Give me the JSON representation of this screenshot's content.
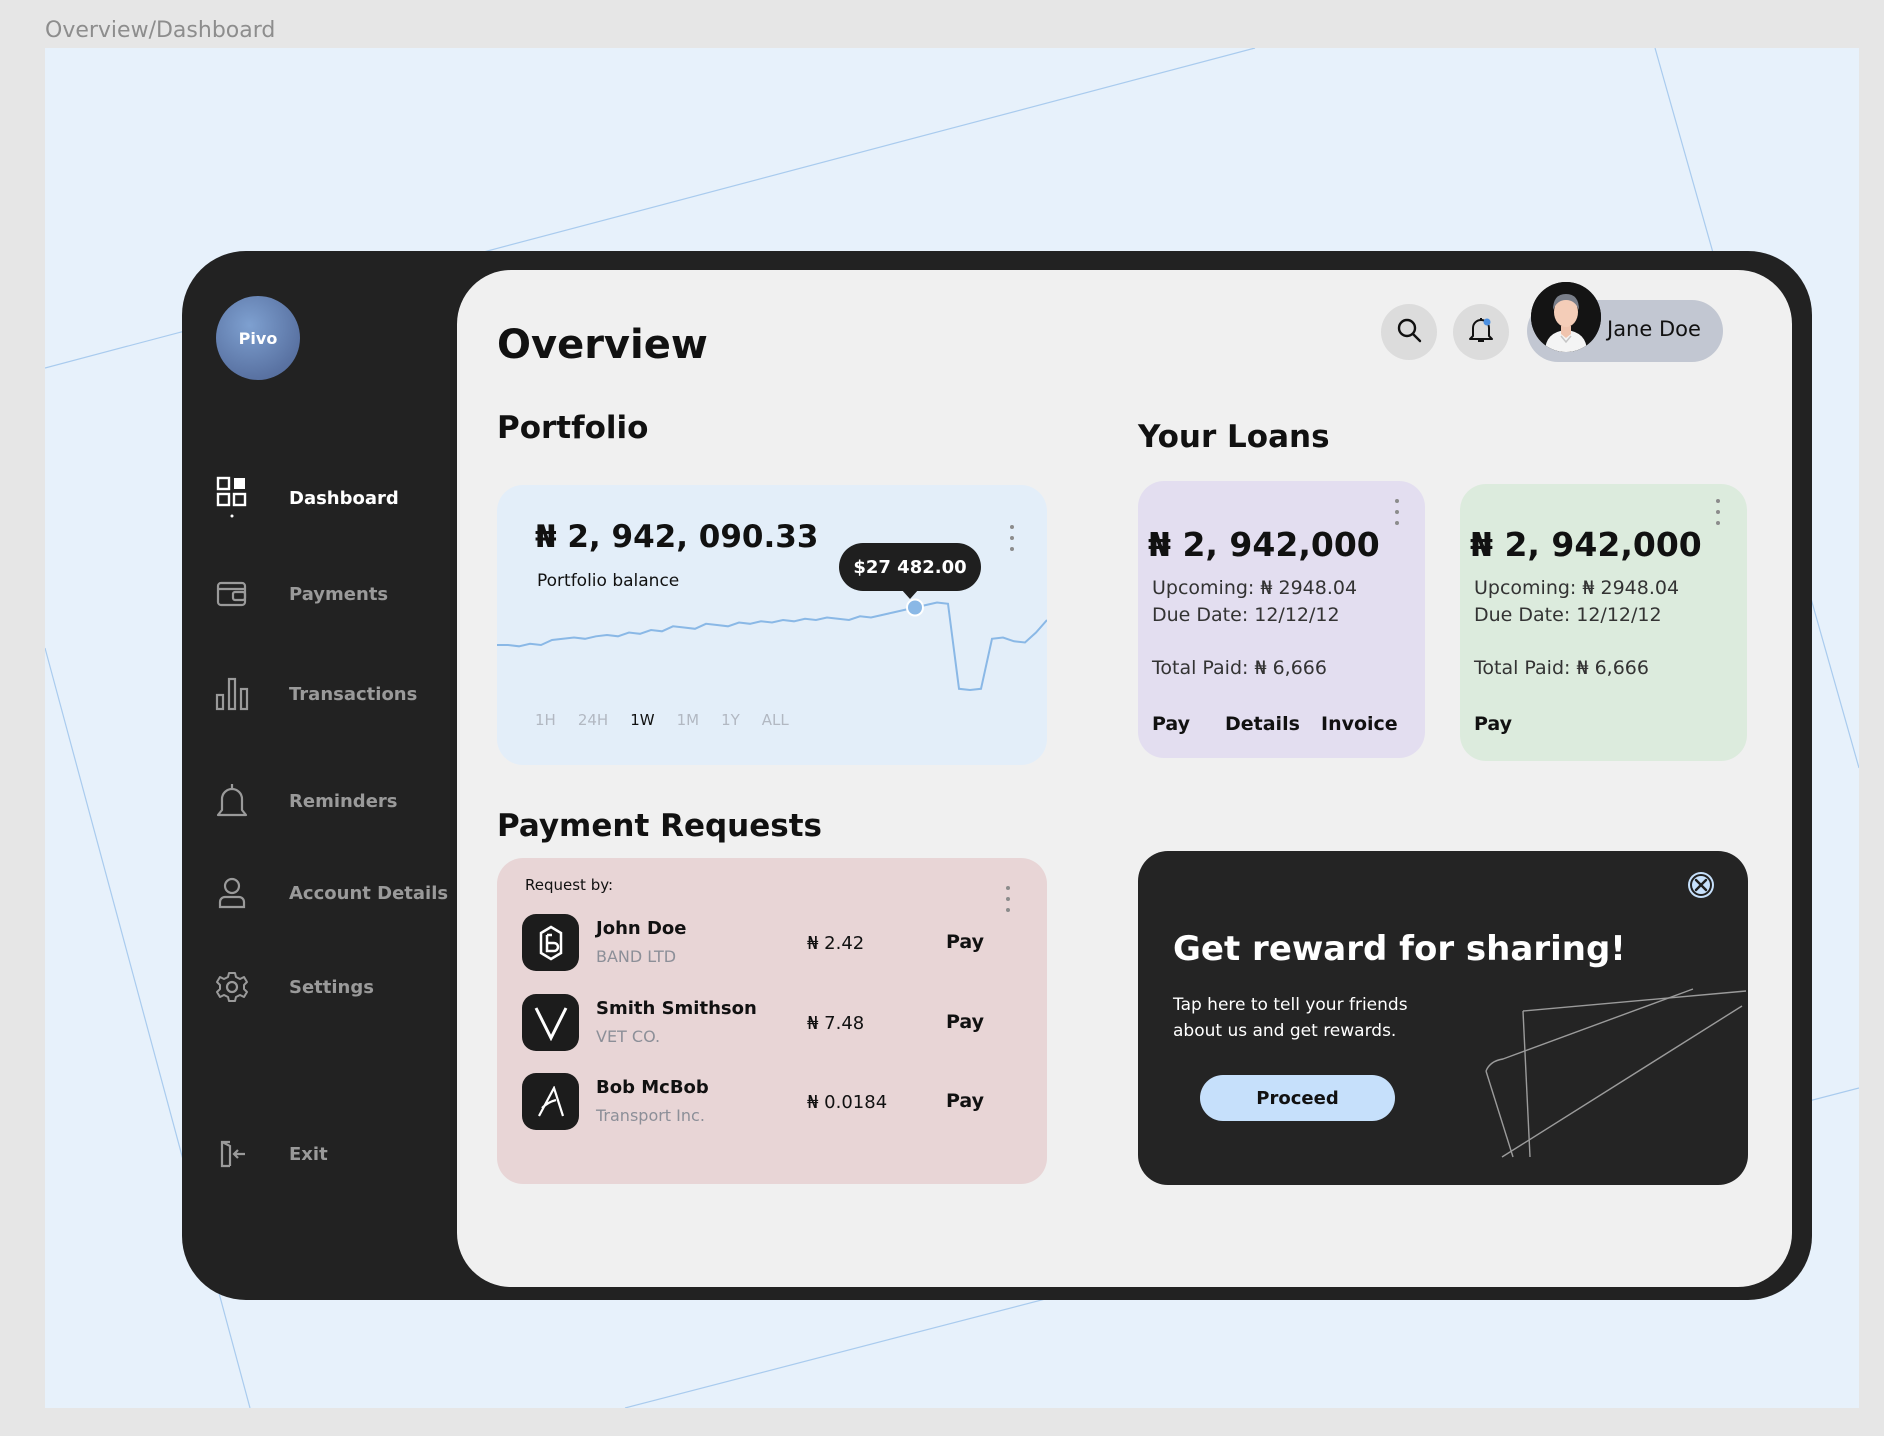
{
  "frame_label": "Overview/Dashboard",
  "brand": {
    "logo_text": "Pivo"
  },
  "sidebar": {
    "items": [
      {
        "label": "Dashboard",
        "icon": "dashboard-grid-icon",
        "active": true
      },
      {
        "label": "Payments",
        "icon": "wallet-icon"
      },
      {
        "label": "Transactions",
        "icon": "bar-chart-icon"
      },
      {
        "label": "Reminders",
        "icon": "bell-icon"
      },
      {
        "label": "Account Details",
        "icon": "user-icon"
      },
      {
        "label": "Settings",
        "icon": "gear-icon"
      }
    ],
    "exit_label": "Exit"
  },
  "header": {
    "title": "Overview",
    "user_name": "Jane Doe",
    "search_icon": "search-icon",
    "notification_icon": "bell-notification-icon"
  },
  "portfolio": {
    "section_title": "Portfolio",
    "balance": "₦ 2, 942, 090.33",
    "balance_label": "Portfolio balance",
    "tooltip": "$27 482.00",
    "ranges": [
      "1H",
      "24H",
      "1W",
      "1M",
      "1Y",
      "ALL"
    ],
    "active_range": "1W"
  },
  "chart_data": {
    "type": "line",
    "series": [
      {
        "values": [
          40,
          40,
          39,
          41,
          40,
          44,
          45,
          46,
          45,
          47,
          48,
          47,
          50,
          49,
          52,
          51,
          55,
          54,
          53,
          57,
          56,
          55,
          58,
          57,
          59,
          58,
          60,
          59,
          61,
          60,
          62,
          61,
          60,
          63,
          62,
          64,
          66,
          68,
          70,
          72,
          74,
          73,
          5,
          4,
          5,
          45,
          46,
          43,
          42,
          50,
          60
        ]
      }
    ],
    "highlight_value": 27482.0,
    "highlight_label": "$27 482.00",
    "grid": false,
    "legend": "none"
  },
  "loans": {
    "section_title": "Your Loans",
    "cards": [
      {
        "amount": "₦ 2, 942,000",
        "upcoming": "Upcoming: ₦ 2948.04",
        "due_date": "Due Date: 12/12/12",
        "total_paid": "Total Paid: ₦ 6,666",
        "actions": [
          "Pay",
          "Details",
          "Invoice"
        ],
        "color": "#e3def0"
      },
      {
        "amount": "₦ 2, 942,000",
        "upcoming": "Upcoming: ₦ 2948.04",
        "due_date": "Due Date: 12/12/12",
        "total_paid": "Total Paid: ₦ 6,666",
        "actions": [
          "Pay"
        ],
        "color": "#dcebdd"
      }
    ]
  },
  "payment_requests": {
    "section_title": "Payment Requests",
    "header": "Request by:",
    "rows": [
      {
        "name": "John Doe",
        "company": "BAND LTD",
        "amount": "₦ 2.42",
        "action": "Pay",
        "logo_icon": "band-logo-icon"
      },
      {
        "name": "Smith Smithson",
        "company": "VET CO.",
        "amount": "₦ 7.48",
        "action": "Pay",
        "logo_icon": "v-logo-icon"
      },
      {
        "name": "Bob McBob",
        "company": "Transport Inc.",
        "amount": "₦ 0.0184",
        "action": "Pay",
        "logo_icon": "a-logo-icon"
      }
    ]
  },
  "reward": {
    "title": "Get reward for sharing!",
    "text": "Tap here to tell your friends about us and get rewards.",
    "button": "Proceed",
    "close_icon": "close-circle-icon"
  },
  "colors": {
    "sidebar_bg": "#222222",
    "main_bg": "#f0f0f0",
    "accent_blue": "#8ab8e6",
    "portfolio_card": "#e3eef9",
    "requests_card": "#e8d5d6",
    "proceed_button": "#c6e0fb"
  }
}
